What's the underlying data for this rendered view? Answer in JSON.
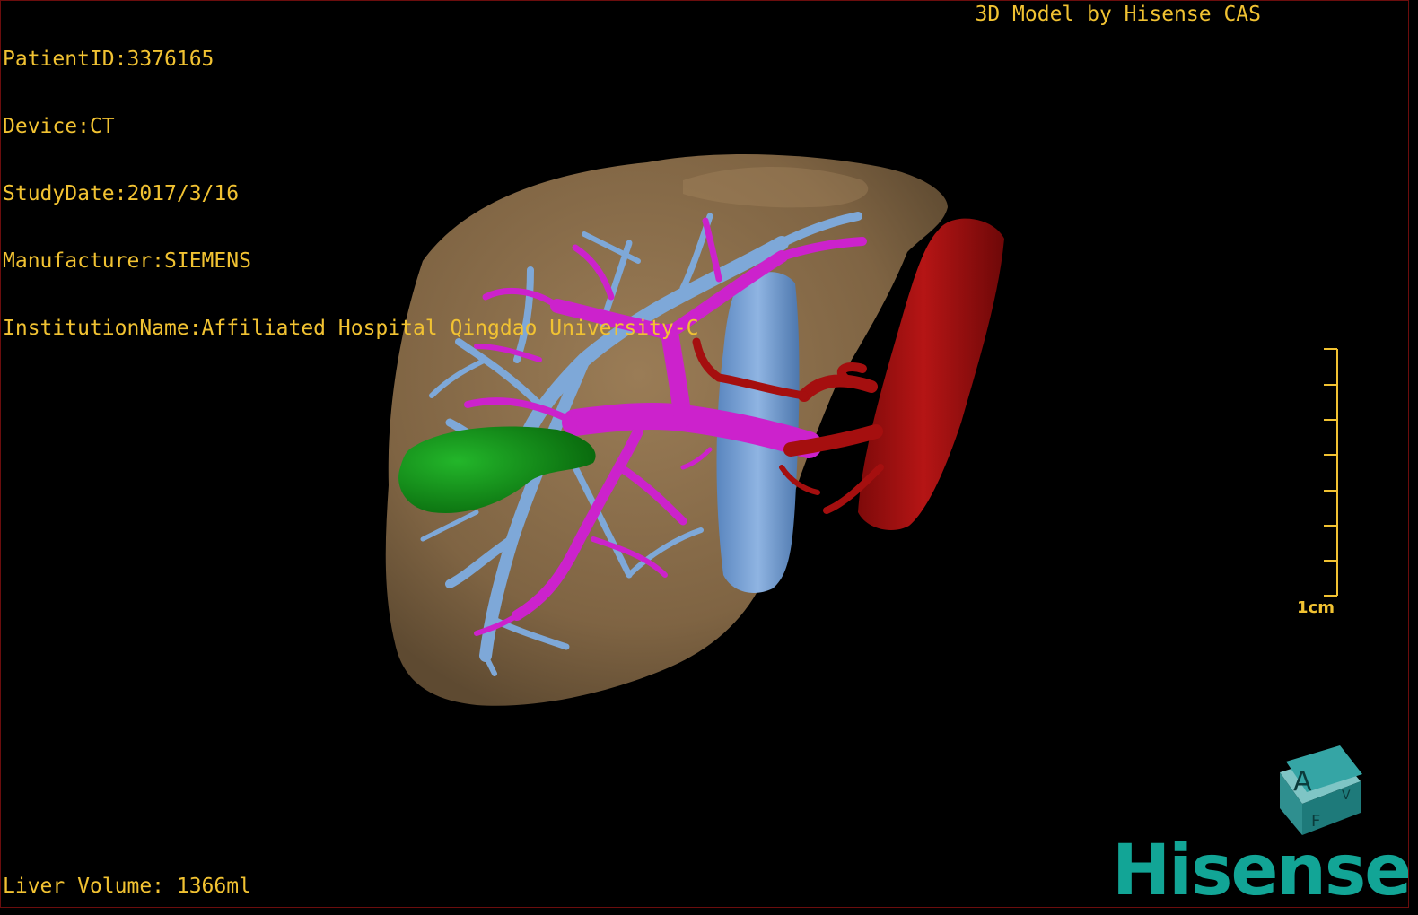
{
  "header": {
    "patient_id": "PatientID:3376165",
    "device": "Device:CT",
    "study_date": "StudyDate:2017/3/16",
    "manufacturer": "Manufacturer:SIEMENS",
    "institution": "InstitutionName:Affiliated Hospital Qingdao University-C"
  },
  "credit": "3D Model by Hisense CAS",
  "footer": {
    "liver_volume": "Liver Volume: 1366ml"
  },
  "scale_bar": {
    "label": "1cm"
  },
  "orientation_cube": {
    "front": "A",
    "bottom": "F",
    "side": "V"
  },
  "brand": {
    "logo": "Hisense",
    "color": "#12a596"
  },
  "colors": {
    "overlay_text": "#f1c232",
    "liver": "#8a6e4b",
    "portal_vein": "#cc22cc",
    "hepatic_vein": "#7ea8d8",
    "aorta": "#a50f0f",
    "gallbladder": "#0f8a14",
    "background": "#000000"
  }
}
